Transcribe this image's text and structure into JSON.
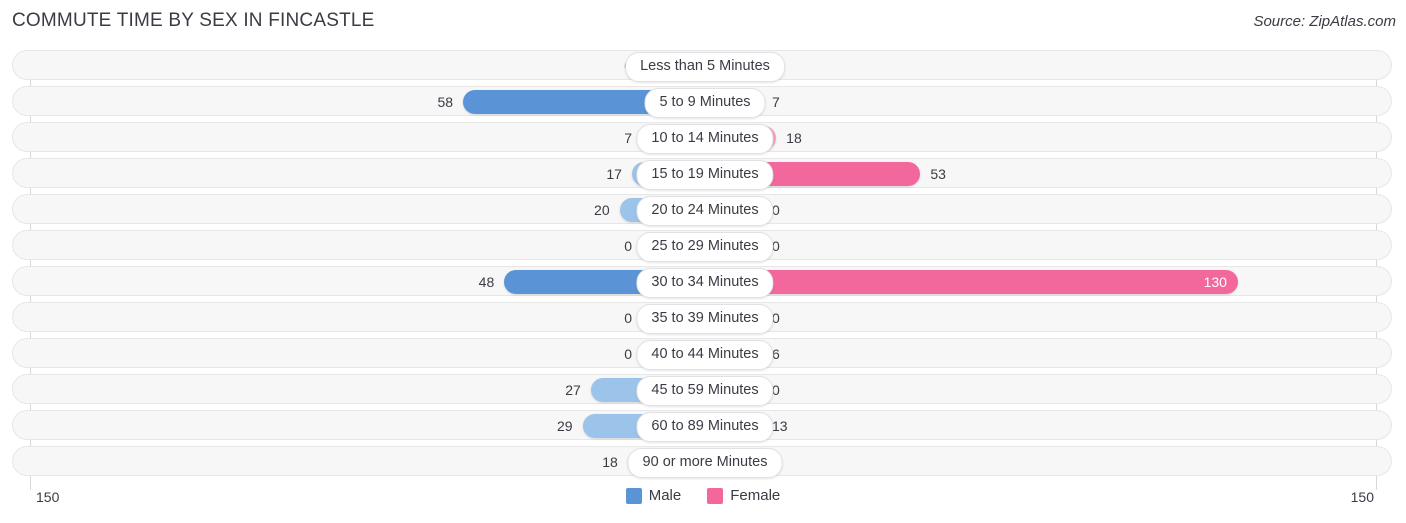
{
  "header": {
    "title": "COMMUTE TIME BY SEX IN FINCASTLE",
    "source": "Source: ZipAtlas.com"
  },
  "axis": {
    "left_label": "150",
    "right_label": "150"
  },
  "legend": {
    "items": [
      {
        "label": "Male",
        "color": "#5b94d6"
      },
      {
        "label": "Female",
        "color": "#f2689c"
      }
    ]
  },
  "chart_data": {
    "type": "bar",
    "orientation": "horizontal-diverging",
    "title": "COMMUTE TIME BY SEX IN FINCASTLE",
    "xlabel": "",
    "ylabel": "",
    "xlim": [
      150,
      150
    ],
    "axis_max": 150,
    "grid": true,
    "legend_position": "bottom-center",
    "categories": [
      "Less than 5 Minutes",
      "5 to 9 Minutes",
      "10 to 14 Minutes",
      "15 to 19 Minutes",
      "20 to 24 Minutes",
      "25 to 29 Minutes",
      "30 to 34 Minutes",
      "35 to 39 Minutes",
      "40 to 44 Minutes",
      "45 to 59 Minutes",
      "60 to 89 Minutes",
      "90 or more Minutes"
    ],
    "series": [
      {
        "name": "Male",
        "color": "#5b94d6",
        "values": [
          0,
          58,
          7,
          17,
          20,
          0,
          48,
          0,
          0,
          27,
          29,
          18
        ]
      },
      {
        "name": "Female",
        "color": "#f2689c",
        "values": [
          0,
          7,
          18,
          53,
          0,
          0,
          130,
          0,
          6,
          0,
          13,
          0
        ]
      }
    ]
  },
  "rows": [
    {
      "label": "Less than 5 Minutes",
      "male": "0",
      "female": "0"
    },
    {
      "label": "5 to 9 Minutes",
      "male": "58",
      "female": "7"
    },
    {
      "label": "10 to 14 Minutes",
      "male": "7",
      "female": "18"
    },
    {
      "label": "15 to 19 Minutes",
      "male": "17",
      "female": "53"
    },
    {
      "label": "20 to 24 Minutes",
      "male": "20",
      "female": "0"
    },
    {
      "label": "25 to 29 Minutes",
      "male": "0",
      "female": "0"
    },
    {
      "label": "30 to 34 Minutes",
      "male": "48",
      "female": "130"
    },
    {
      "label": "35 to 39 Minutes",
      "male": "0",
      "female": "0"
    },
    {
      "label": "40 to 44 Minutes",
      "male": "0",
      "female": "6"
    },
    {
      "label": "45 to 59 Minutes",
      "male": "27",
      "female": "0"
    },
    {
      "label": "60 to 89 Minutes",
      "male": "29",
      "female": "13"
    },
    {
      "label": "90 or more Minutes",
      "male": "18",
      "female": "0"
    }
  ]
}
